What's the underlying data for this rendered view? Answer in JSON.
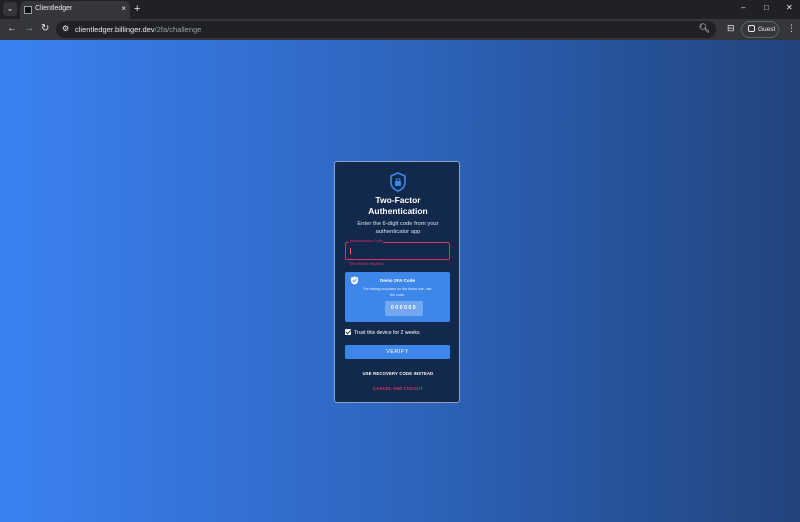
{
  "browser": {
    "tab_title": "Clientledger",
    "url_host": "clientledger.billinger.dev",
    "url_path": "/2fa/challenge",
    "profile_label": "Guest",
    "icons": {
      "tab_search": "chevron-down",
      "favicon": "app-favicon",
      "tab_close": "×",
      "new_tab": "+",
      "minimize": "–",
      "maximize": "□",
      "close": "✕",
      "back": "←",
      "forward": "→",
      "reload": "↻",
      "site_info": "⚙",
      "zoom": "🔍︎",
      "cast": "⊟",
      "menu": "⋮"
    }
  },
  "auth": {
    "title_line1": "Two-Factor",
    "title_line2": "Authentication",
    "subtitle": "Enter the 6-digit code from your authenticator app",
    "code_label": "Authentication Code",
    "code_value": "",
    "field_error": "This field is required",
    "demo_title": "Demo 2FA Code",
    "demo_note": "For testing purposes on the demo site, use the code:",
    "demo_code": "000000",
    "trust_label": "Trust this device for 2 weeks",
    "trust_checked": true,
    "verify_label": "VERIFY",
    "recovery_label": "USE RECOVERY CODE INSTEAD",
    "cancel_label": "CANCEL AND LOGOUT"
  },
  "colors": {
    "card_bg": "#13294c",
    "accent": "#3d86ea",
    "error": "#e1315f"
  }
}
